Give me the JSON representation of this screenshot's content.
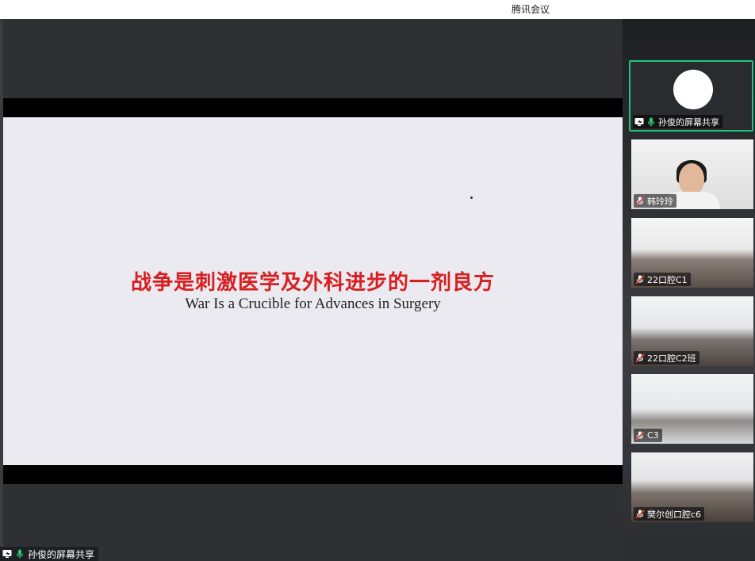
{
  "app": {
    "title": "腾讯会议"
  },
  "slide": {
    "title_cn": "战争是刺激医学及外科进步的一剂良方",
    "title_en": "War Is a Crucible for Advances in Surgery"
  },
  "share_indicator": {
    "label": "孙俊的屏幕共享"
  },
  "participants": [
    {
      "label": "孙俊的屏幕共享",
      "icon": "screen-share-icon",
      "mic": "mic-on-icon",
      "active": true
    },
    {
      "label": "韩玲玲",
      "mic": "mic-muted-icon"
    },
    {
      "label": "22口腔C1",
      "mic": "mic-muted-icon"
    },
    {
      "label": "22口腔C2班",
      "mic": "mic-muted-icon"
    },
    {
      "label": "C3",
      "mic": "mic-muted-icon"
    },
    {
      "label": "樊尔创口腔c6",
      "mic": "mic-muted-icon"
    }
  ],
  "colors": {
    "active_border": "#1fc77e",
    "mic_on": "#2ecc71",
    "mic_muted": "#e74c3c",
    "slide_title": "#d81f1f"
  }
}
